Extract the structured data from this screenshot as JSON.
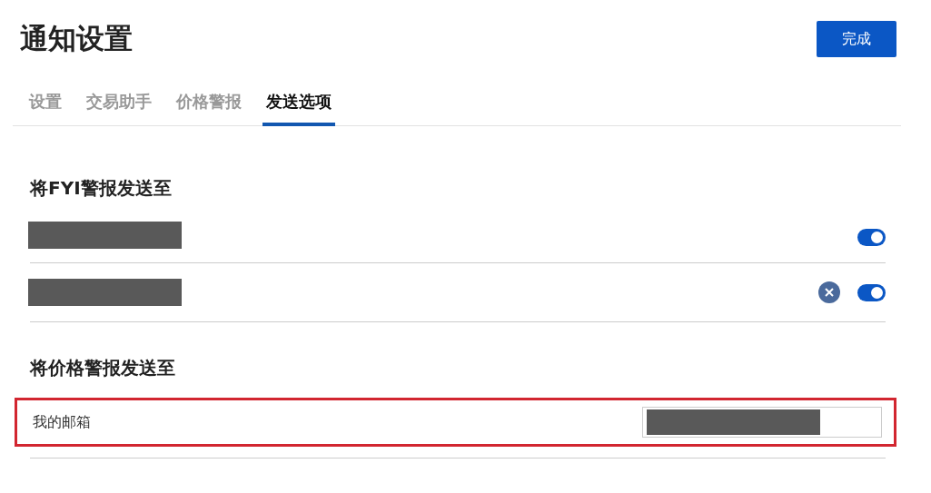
{
  "title": "通知设置",
  "done_button": "完成",
  "tabs": [
    {
      "label": "设置",
      "selected": false
    },
    {
      "label": "交易助手",
      "selected": false
    },
    {
      "label": "价格警报",
      "selected": false
    },
    {
      "label": "发送选项",
      "selected": true
    }
  ],
  "sections": [
    {
      "heading": "将FYI警报发送至",
      "rows": [
        {
          "kind": "toggle",
          "removable": false,
          "on": true
        },
        {
          "kind": "toggle",
          "removable": true,
          "on": true
        }
      ]
    },
    {
      "heading": "将价格警报发送至",
      "rows": [
        {
          "kind": "email",
          "label": "我的邮箱",
          "highlighted": true
        }
      ]
    }
  ]
}
